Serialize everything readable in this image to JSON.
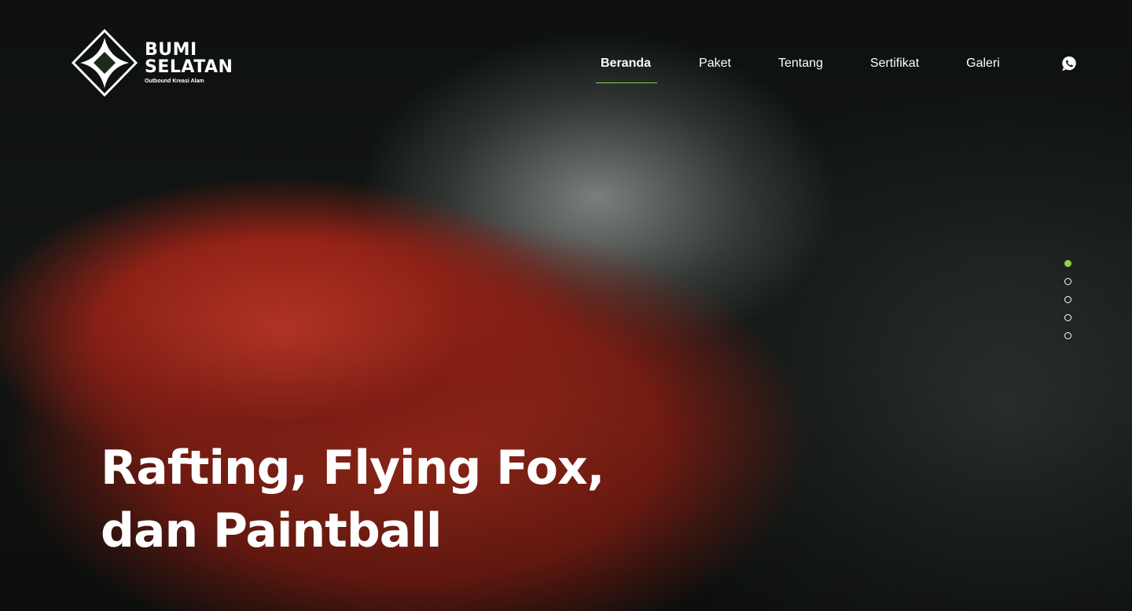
{
  "brand": {
    "line1": "BUMI",
    "line2": "SELATAN",
    "tagline": "Outbound Kreasi Alam"
  },
  "nav": {
    "items": [
      {
        "label": "Beranda",
        "active": true
      },
      {
        "label": "Paket",
        "active": false
      },
      {
        "label": "Tentang",
        "active": false
      },
      {
        "label": "Sertifikat",
        "active": false
      },
      {
        "label": "Galeri",
        "active": false
      }
    ],
    "contact_icon": "whatsapp-icon"
  },
  "hero": {
    "headline_line1": "Rafting, Flying Fox,",
    "headline_line2": "dan Paintball"
  },
  "slider": {
    "count": 5,
    "active_index": 0
  },
  "colors": {
    "accent": "#8fd14f",
    "text": "#ffffff"
  }
}
